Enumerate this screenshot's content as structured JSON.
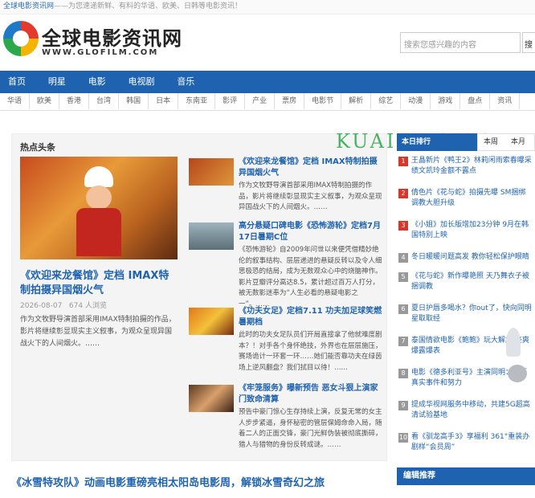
{
  "topbar": {
    "site": "全球电影资讯网",
    "slogan": "——为您速递新鲜、有料的华语、欧美、日韩等电影资讯！"
  },
  "logo": {
    "cn": "全球电影资讯网",
    "en": "WWW.GLOFILM.COM"
  },
  "search": {
    "placeholder": "搜索您感兴趣的内容",
    "button": "搜索"
  },
  "nav": [
    "首页",
    "明星",
    "电影",
    "电视剧",
    "音乐"
  ],
  "subnav": [
    "华语",
    "欧美",
    "香港",
    "台湾",
    "韩国",
    "日本",
    "东南亚",
    "影评",
    "产业",
    "票房",
    "电影节",
    "解析",
    "综艺",
    "动漫",
    "游戏",
    "盘点",
    "资讯"
  ],
  "watermark": "KUAIMAO.COM",
  "hot": {
    "section_title": "热点头条",
    "big": {
      "title": "《欢迎来龙餐馆》定档 IMAX特制拍摄异国烟火气",
      "date": "2026-08-07",
      "views": "674 人浏览",
      "desc": "作为文牧野导演首部采用IMAX特制拍摄的作品，影片将继续彰显现实主义叙事，为观众呈现异国战火下的人间烟火。……"
    },
    "items": [
      {
        "title": "《欢迎来龙餐馆》定档 IMAX特制拍摄异国烟火气",
        "desc": "作为文牧野导演首部采用IMAX特制拍摄的作品，影片将继续彰显现实主义叙事，为观众呈现异国战火下的人间烟火。……"
      },
      {
        "title": "高分悬疑口碑电影《恐怖游轮》定档7月17日暑期C位",
        "desc": "《恐怖游轮》自2009年问世以来便凭借精妙绝伦的叙事结构、层层递进的悬疑反转以及令人细思极恐的结局，成为无数观众心中的烧脑神作。影片豆瓣评分高达8.5，累计超过百万人打分，被无数影迷奉为“人生必看的悬疑电影之一”。……"
      },
      {
        "title": "《功夫女足》定档7.11 功夫加足球笑燃暑期档",
        "desc": "此时的功夫女足队员们开局直接拿了他就难度剧本？！对手各个身怀绝技，外界也在层层施压，赛场诡计一环套一环……她们能否靠功夫在绿茵场上逆风翻盘？我们拭目以待！……"
      },
      {
        "title": "《牢笼服务》曝新预告 恶女斗狠上演家门致命清算",
        "desc": "预告中豪门惊心生存持续上演，反复无常的女主人步步紧逼，身怀秘密的管层保姆命命入局，随着二人的正面交锋，豪门光鲜伪装被彻底撕碎，猎人与猎物的身份反转成谜。……"
      }
    ]
  },
  "sidebar": {
    "tabs": {
      "active": "本日排行",
      "week": "本周",
      "month": "本月"
    },
    "ranks": [
      {
        "n": "1",
        "t": "王晶新片《鸭王2》林莉闲雨索春曝采绩文凯玲金额不露点"
      },
      {
        "n": "2",
        "t": "倩色片《花与蛇》拍摄先曝 SM捆绑调教大胆升级"
      },
      {
        "n": "3",
        "t": "《小姐》加长版增加23分钟 9月在韩国特别上映"
      },
      {
        "n": "4",
        "t": "冬日暖暖问题高发 教你轻松保护眼睛"
      },
      {
        "n": "5",
        "t": "《花与蛇》新作曝艳照 天乃舞衣子被捆调教"
      },
      {
        "n": "6",
        "t": "夏日护唇多喝水？你out了，快向同明星取取经"
      },
      {
        "n": "7",
        "t": "泰国情欲电影《鲍鲍》玩大解放 豪爽爆露爆表"
      },
      {
        "n": "8",
        "t": "电影《德多利亚号》主演同明：还原真实事件和努力"
      },
      {
        "n": "9",
        "t": "提成华视网服务中移动，共建5G超高清试验基地"
      },
      {
        "n": "10",
        "t": "看《驯龙高手3》享福利 361°重装办剧样“会员周”"
      }
    ],
    "rec_title": "编辑推荐"
  },
  "bottom": {
    "title": "《冰雪特攻队》动画电影重磅亮相太阳岛电影周，解锁冰雪奇幻之旅"
  }
}
